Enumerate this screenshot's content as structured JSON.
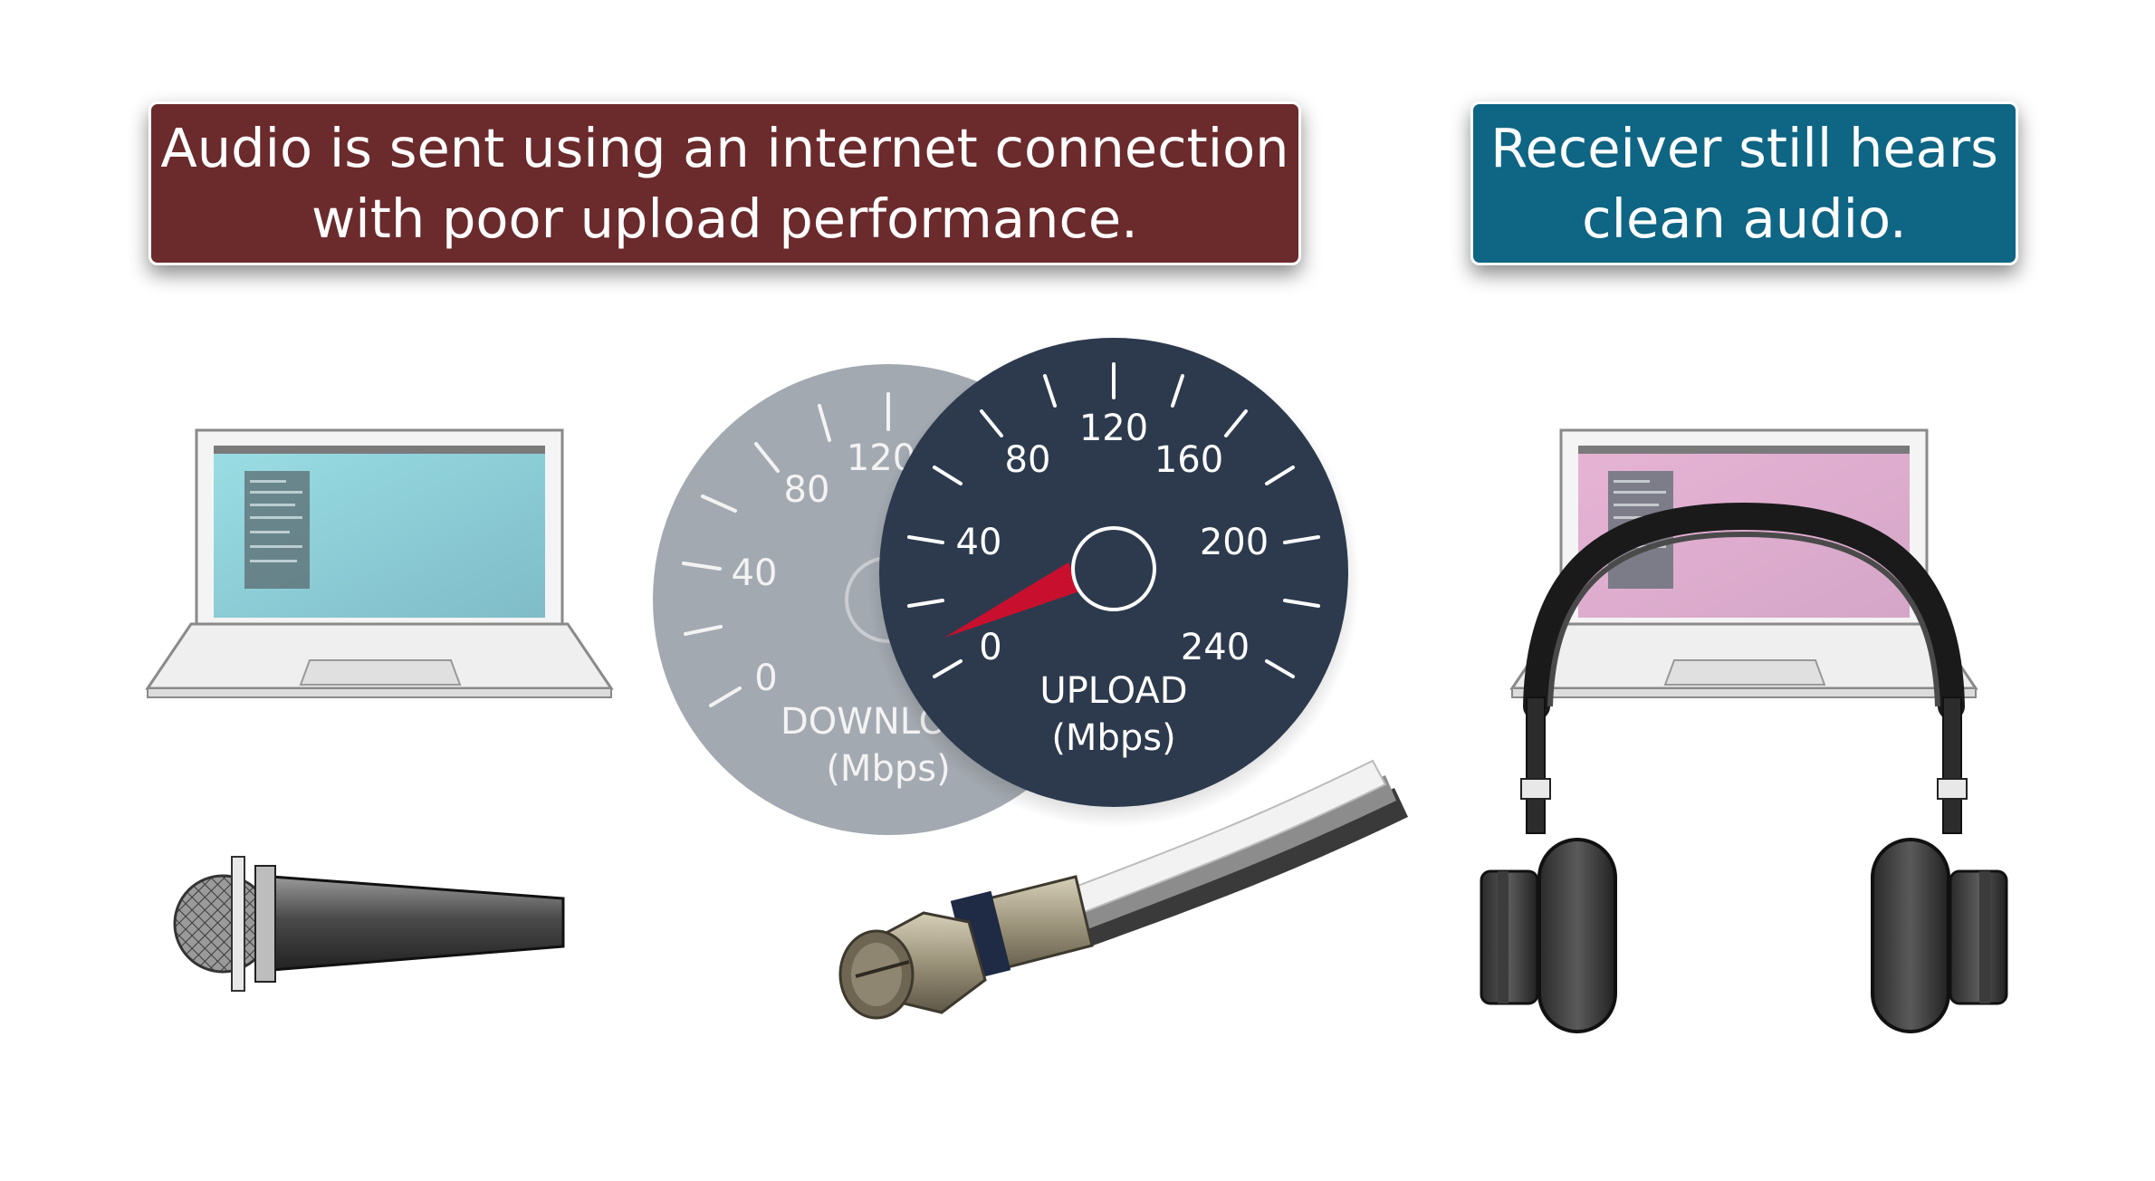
{
  "banners": {
    "left": {
      "line1": "Audio is sent using an internet connection",
      "line2": "with poor upload performance.",
      "color": "#6b2a2c"
    },
    "right": {
      "line1": "Receiver still hears",
      "line2": "clean audio.",
      "color": "#0e6584"
    }
  },
  "download_gauge": {
    "label": "DOWNLO",
    "unit": "(Mbps)",
    "ticks": [
      "0",
      "40",
      "80",
      "120"
    ]
  },
  "upload_gauge": {
    "label": "UPLOAD",
    "unit": "(Mbps)",
    "ticks": [
      "0",
      "40",
      "80",
      "120",
      "160",
      "200",
      "240"
    ],
    "needle_value": 0,
    "needle_color": "#c8102e"
  },
  "screens": {
    "sender_color": "#8fd3dc",
    "receiver_color": "#dcadd0"
  },
  "icons": [
    "laptop-icon",
    "microphone-icon",
    "coax-cable-icon",
    "headphones-icon"
  ]
}
